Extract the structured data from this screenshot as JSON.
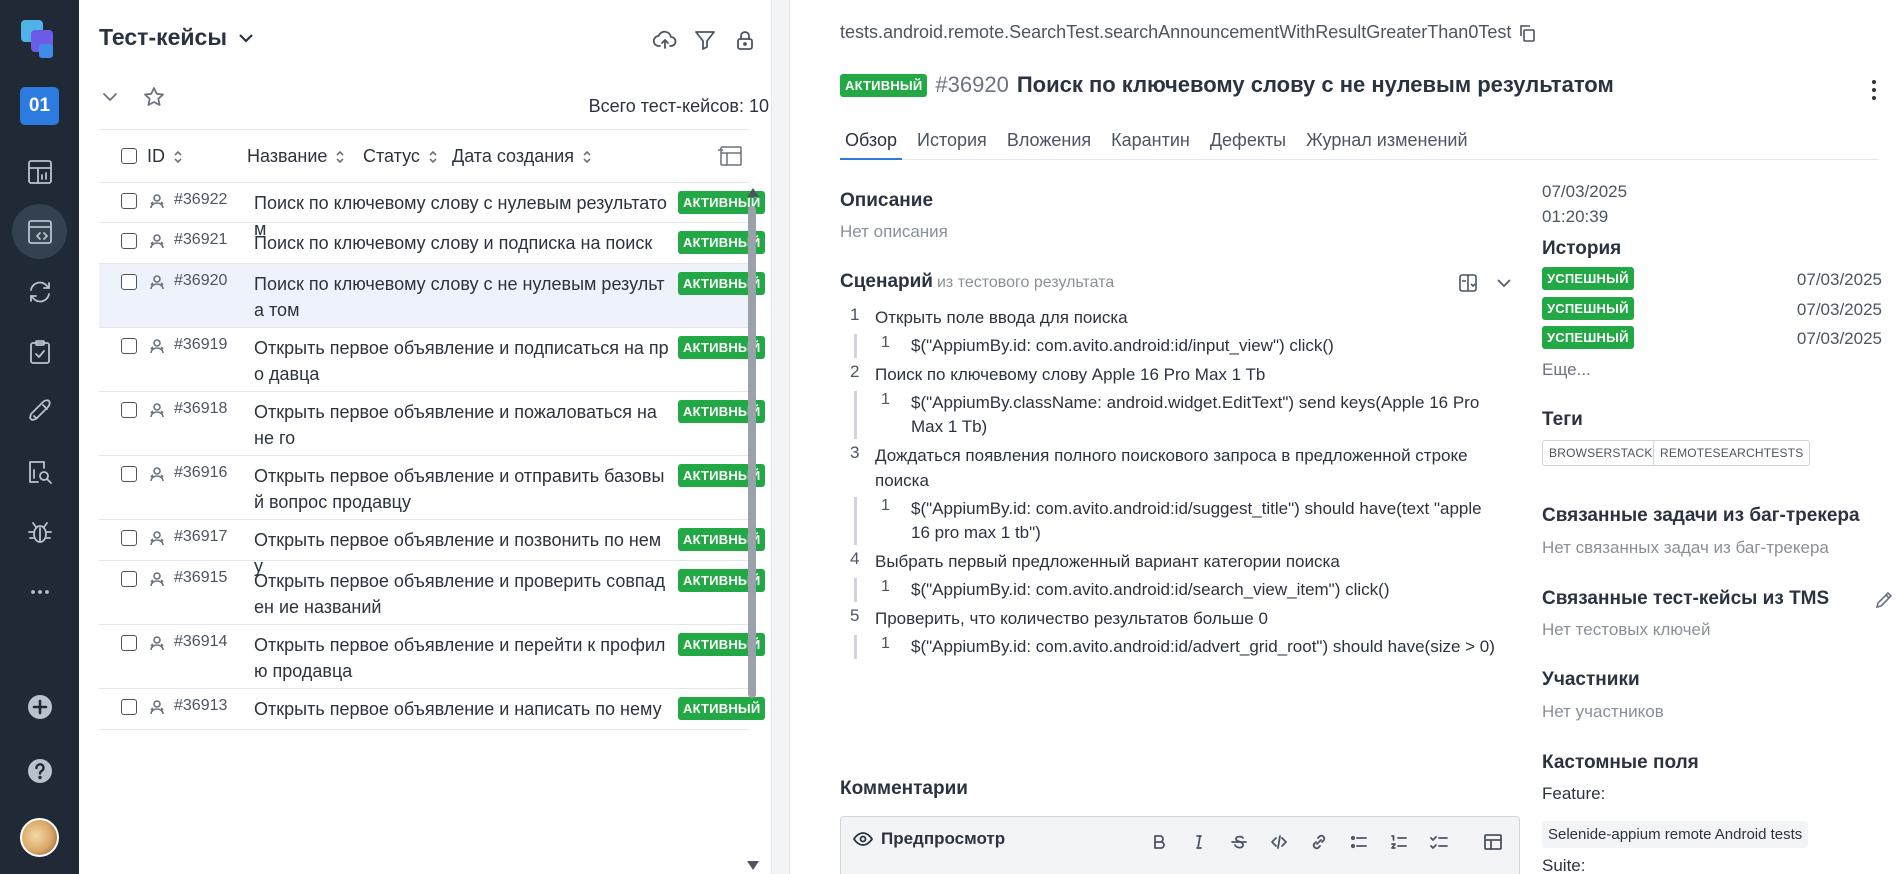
{
  "rail": {
    "project_code": "01",
    "items": [
      "dashboards-icon",
      "testcases-icon",
      "launches-icon",
      "testplans-icon",
      "deploy-icon",
      "analytics-icon",
      "defects-icon",
      "more-icon"
    ]
  },
  "list": {
    "title": "Тест-кейсы",
    "total_text": "Всего тест-кейсов: 10",
    "columns": {
      "id": "ID",
      "name": "Название",
      "status": "Статус",
      "created": "Дата создания"
    },
    "rows": [
      {
        "id": "#36922",
        "name": "Поиск по ключевому слову с нулевым результатом",
        "status": "АКТИВНЫЙ"
      },
      {
        "id": "#36921",
        "name": "Поиск по ключевому слову и подписка на поиск",
        "status": "АКТИВНЫЙ"
      },
      {
        "id": "#36920",
        "name": "Поиск по ключевому слову с не нулевым результа том",
        "status": "АКТИВНЫЙ"
      },
      {
        "id": "#36919",
        "name": "Открыть первое объявление и подписаться на про давца",
        "status": "АКТИВНЫЙ"
      },
      {
        "id": "#36918",
        "name": "Открыть первое объявление и пожаловаться на не го",
        "status": "АКТИВНЫЙ"
      },
      {
        "id": "#36916",
        "name": "Открыть первое объявление и отправить базовый вопрос продавцу",
        "status": "АКТИВНЫЙ"
      },
      {
        "id": "#36917",
        "name": "Открыть первое объявление и позвонить по нему",
        "status": "АКТИВНЫЙ"
      },
      {
        "id": "#36915",
        "name": "Открыть первое объявление и проверить совпаден ие названий",
        "status": "АКТИВНЫЙ"
      },
      {
        "id": "#36914",
        "name": "Открыть первое объявление и перейти к профилю продавца",
        "status": "АКТИВНЫЙ"
      },
      {
        "id": "#36913",
        "name": "Открыть первое объявление и написать по нему",
        "status": "АКТИВНЫЙ"
      }
    ]
  },
  "detail": {
    "full_name": "tests.android.remote.SearchTest.searchAnnouncementWithResultGreaterThan0Test",
    "status": "АКТИВНЫЙ",
    "number": "#36920",
    "title": "Поиск по ключевому слову с не нулевым результатом",
    "tabs": [
      "Обзор",
      "История",
      "Вложения",
      "Карантин",
      "Дефекты",
      "Журнал изменений"
    ],
    "description_heading": "Описание",
    "description_empty": "Нет описания",
    "scenario_heading": "Сценарий",
    "scenario_source": "из тестового результата",
    "steps": [
      {
        "n": "1",
        "text": "Открыть поле ввода для поиска",
        "sub": [
          {
            "n": "1",
            "text": "$(\"AppiumBy.id: com.avito.android:id/input_view\") click()"
          }
        ]
      },
      {
        "n": "2",
        "text": "Поиск по ключевому слову Apple 16 Pro Max 1 Tb",
        "sub": [
          {
            "n": "1",
            "text": "$(\"AppiumBy.className: android.widget.EditText\") send keys(Apple 16 Pro Max 1 Tb)"
          }
        ]
      },
      {
        "n": "3",
        "text": "Дождаться появления полного поискового запроса в предложенной строке поиска",
        "sub": [
          {
            "n": "1",
            "text": "$(\"AppiumBy.id: com.avito.android:id/suggest_title\") should have(text \"apple 16 pro max 1 tb\")"
          }
        ]
      },
      {
        "n": "4",
        "text": "Выбрать первый предложенный вариант категории поиска",
        "sub": [
          {
            "n": "1",
            "text": "$(\"AppiumBy.id: com.avito.android:id/search_view_item\") click()"
          }
        ]
      },
      {
        "n": "5",
        "text": "Проверить, что количество результатов больше 0",
        "sub": [
          {
            "n": "1",
            "text": "$(\"AppiumBy.id: com.avito.android:id/advert_grid_root\") should have(size > 0)"
          }
        ]
      }
    ],
    "comments_heading": "Комментарии",
    "preview_label": "Предпросмотр",
    "created_date": "07/03/2025",
    "created_time": "01:20:39",
    "history_heading": "История",
    "history": [
      {
        "status": "УСПЕШНЫЙ",
        "date": "07/03/2025"
      },
      {
        "status": "УСПЕШНЫЙ",
        "date": "07/03/2025"
      },
      {
        "status": "УСПЕШНЫЙ",
        "date": "07/03/2025"
      }
    ],
    "history_more": "Еще...",
    "tags_heading": "Теги",
    "tags": [
      "BROWSERSTACK",
      "REMOTESEARCHTESTS"
    ],
    "issues_heading": "Связанные задачи из баг-трекера",
    "issues_empty": "Нет связанных задач из баг-трекера",
    "tms_heading": "Связанные тест-кейсы из TMS",
    "tms_empty": "Нет тестовых ключей",
    "members_heading": "Участники",
    "members_empty": "Нет участников",
    "custom_heading": "Кастомные поля",
    "feature_label": "Feature:",
    "feature_value": "Selenide-appium remote Android tests",
    "suite_label": "Suite:"
  },
  "colors": {
    "rail_bg": "#1f2a36",
    "accent": "#2d7be0",
    "status_green": "#22a845"
  }
}
